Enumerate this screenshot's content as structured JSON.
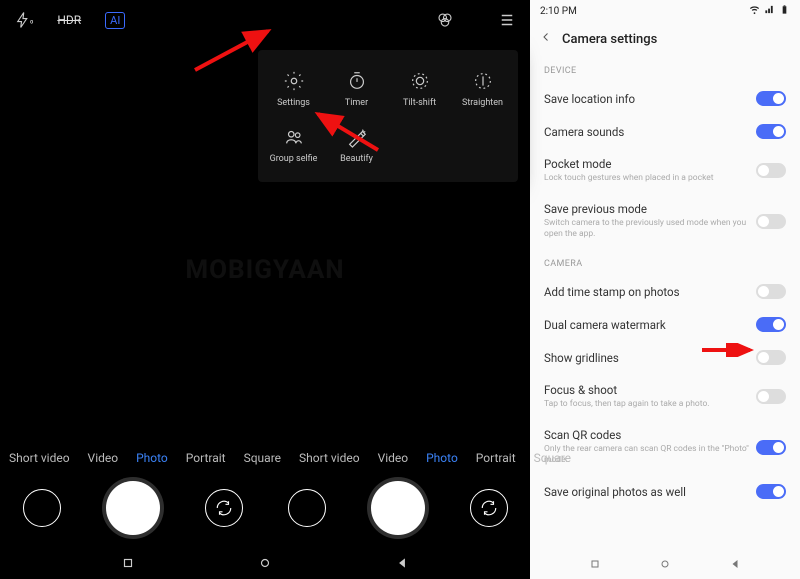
{
  "leftPane": {
    "topbar": {
      "flash": "⚡",
      "hdr": "HDR",
      "ai": "AI",
      "filters": "filters",
      "menu": "menu"
    },
    "popup": {
      "items": [
        {
          "label": "Settings"
        },
        {
          "label": "Timer"
        },
        {
          "label": "Tilt-shift"
        },
        {
          "label": "Straighten"
        },
        {
          "label": "Group selfie"
        },
        {
          "label": "Beautify"
        }
      ]
    },
    "watermark": "MOBIGYAAN",
    "modes": [
      {
        "label": "Short video",
        "active": false
      },
      {
        "label": "Video",
        "active": false
      },
      {
        "label": "Photo",
        "active": true
      },
      {
        "label": "Portrait",
        "active": false
      },
      {
        "label": "Square",
        "active": false
      },
      {
        "label": "Short video",
        "active": false
      },
      {
        "label": "Video",
        "active": false
      },
      {
        "label": "Photo",
        "active": true
      },
      {
        "label": "Portrait",
        "active": false
      },
      {
        "label": "Square",
        "active": false
      }
    ]
  },
  "rightPane": {
    "status": {
      "time": "2:10 PM"
    },
    "header": {
      "title": "Camera settings"
    },
    "sections": [
      {
        "title": "DEVICE",
        "items": [
          {
            "title": "Save location info",
            "sub": "",
            "on": true
          },
          {
            "title": "Camera sounds",
            "sub": "",
            "on": true
          },
          {
            "title": "Pocket mode",
            "sub": "Lock touch gestures when placed in a pocket",
            "on": false
          },
          {
            "title": "Save previous mode",
            "sub": "Switch camera to the previously used mode when you open the app.",
            "on": false
          }
        ]
      },
      {
        "title": "CAMERA",
        "items": [
          {
            "title": "Add time stamp on photos",
            "sub": "",
            "on": false
          },
          {
            "title": "Dual camera watermark",
            "sub": "",
            "on": true
          },
          {
            "title": "Show gridlines",
            "sub": "",
            "on": false
          },
          {
            "title": "Focus & shoot",
            "sub": "Tap to focus, then tap again to take a photo.",
            "on": false
          },
          {
            "title": "Scan QR codes",
            "sub": "Only the rear camera can scan QR codes in the \"Photo\" mode.",
            "on": true
          },
          {
            "title": "Save original photos as well",
            "sub": "",
            "on": true
          }
        ]
      }
    ]
  }
}
